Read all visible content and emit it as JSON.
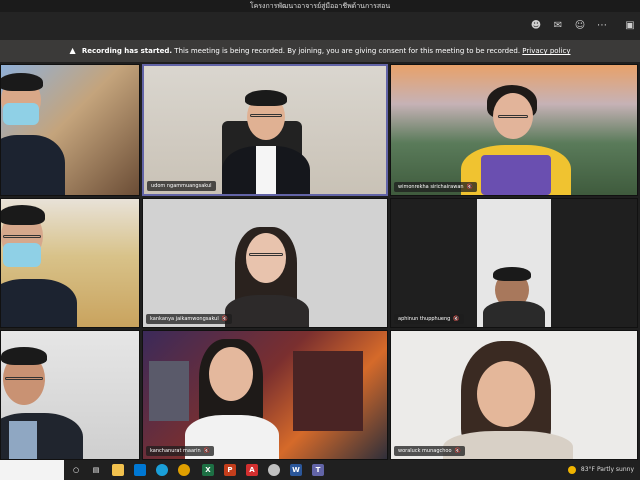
{
  "window": {
    "title": "โครงการพัฒนาอาจารย์สู่มืออาชีพด้านการสอน"
  },
  "banner": {
    "bold": "Recording has started.",
    "text": "This meeting is being recorded. By joining, you are giving consent for this meeting to be recorded.",
    "link": "Privacy policy"
  },
  "participants": [
    {
      "name": ""
    },
    {
      "name": "udom ngammuangsakul"
    },
    {
      "name": "wimonrekha sirichairawan"
    },
    {
      "name": ""
    },
    {
      "name": "kankanya jaikamwongsakul"
    },
    {
      "name": "aphinun thupphueng"
    },
    {
      "name": ""
    },
    {
      "name": "kanchanurat maarin"
    },
    {
      "name": "woraluck munagchoo"
    }
  ],
  "taskbar": {
    "icons": [
      "search-icon",
      "task-view-icon",
      "file-explorer-icon",
      "store-icon",
      "edge-icon",
      "chrome-icon",
      "excel-icon",
      "powerpoint-icon",
      "acrobat-icon",
      "mail-icon",
      "word-icon",
      "teams-icon"
    ],
    "weather_temp": "83°F",
    "weather_text": "Partly sunny"
  },
  "colors": {
    "accent": "#6264a7",
    "banner_bg": "#3b3a39"
  }
}
